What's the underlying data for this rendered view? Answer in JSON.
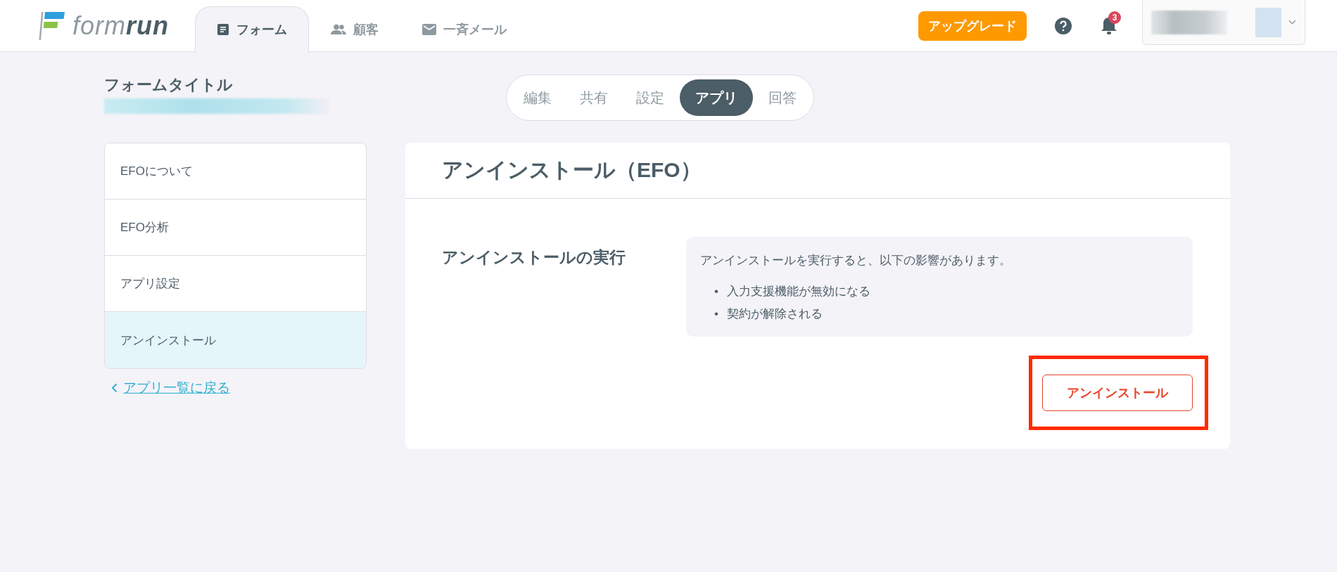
{
  "header": {
    "logo": "form**run**",
    "nav_tabs": [
      {
        "label": "フォーム",
        "kind": "document",
        "selected": true
      },
      {
        "label": "顧客",
        "kind": "people",
        "selected": false
      },
      {
        "label": "一斉メール",
        "kind": "mail",
        "selected": false
      }
    ],
    "upgrade_button": "アップグレード",
    "notification_count": "3"
  },
  "form_title": "フォームタイトル",
  "segment_tabs": [
    {
      "label": "編集",
      "selected": false
    },
    {
      "label": "共有",
      "selected": false
    },
    {
      "label": "設定",
      "selected": false
    },
    {
      "label": "アプリ",
      "selected": true
    },
    {
      "label": "回答",
      "selected": false
    }
  ],
  "sidebar": {
    "items": [
      {
        "label": "EFOについて",
        "selected": false
      },
      {
        "label": "EFO分析",
        "selected": false
      },
      {
        "label": "アプリ設定",
        "selected": false
      },
      {
        "label": "アンインストール",
        "selected": true
      }
    ],
    "back_link": "アプリ一覧に戻る"
  },
  "card": {
    "title": "アンインストール（EFO）",
    "section_title": "アンインストールの実行",
    "notice": "アンインストールを実行すると、以下の影響があります。",
    "effects": [
      {
        "bullet": "•",
        "text": "入力支援機能が無効になる"
      },
      {
        "bullet": "•",
        "text": "契約が解除される"
      }
    ],
    "button": {
      "label": "アンインストール",
      "highlighted": true
    }
  }
}
